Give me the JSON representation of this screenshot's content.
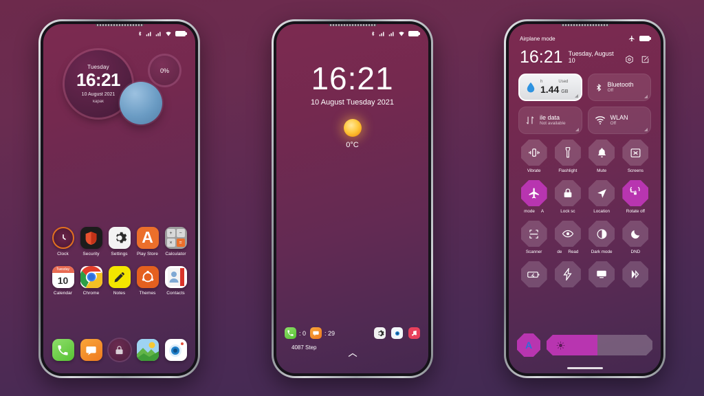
{
  "wallpaper": {
    "bg_top": "#6d2a4c",
    "bg_bottom": "#3f2a52",
    "screen_top": "#7c2a50",
    "screen_bottom": "#45284f",
    "accent": "#b835b0"
  },
  "phone1": {
    "name": "home-screen",
    "statusbar": {
      "icons": [
        "bluetooth-icon",
        "signal-1-icon",
        "signal-2-icon",
        "wifi-icon",
        "battery-icon"
      ]
    },
    "clock_widget": {
      "day": "Tuesday",
      "time": "16:21",
      "date": "10 August 2021",
      "subtitle": "kapak"
    },
    "battery_ring": {
      "value": "0%"
    },
    "apps_row1": [
      {
        "label": "Clock",
        "icon": "clock-icon"
      },
      {
        "label": "Security",
        "icon": "shield-icon"
      },
      {
        "label": "Settings",
        "icon": "gear-icon"
      },
      {
        "label": "Play Store",
        "icon": "play-store-icon"
      },
      {
        "label": "Calculator",
        "icon": "calculator-icon"
      }
    ],
    "apps_row2": [
      {
        "label": "Calendar",
        "icon": "calendar-icon",
        "day_name": "Tuesday",
        "day_num": "10"
      },
      {
        "label": "Chrome",
        "icon": "chrome-icon"
      },
      {
        "label": "Notes",
        "icon": "pencil-icon"
      },
      {
        "label": "Themes",
        "icon": "themes-icon"
      },
      {
        "label": "Contacts",
        "icon": "contacts-icon"
      }
    ],
    "dock": [
      {
        "label": "Phone",
        "icon": "phone-icon"
      },
      {
        "label": "Messages",
        "icon": "message-icon"
      },
      {
        "label": "Lock",
        "icon": "lock-icon"
      },
      {
        "label": "Gallery",
        "icon": "gallery-icon"
      },
      {
        "label": "Camera",
        "icon": "camera-icon"
      }
    ]
  },
  "phone2": {
    "name": "lock-screen",
    "statusbar": {
      "icons": [
        "bluetooth-icon",
        "signal-1-icon",
        "signal-2-icon",
        "wifi-icon",
        "battery-icon"
      ]
    },
    "time": "16:21",
    "date": "10 August Tuesday 2021",
    "weather_icon": "sun-icon",
    "temperature": "0°C",
    "shortcuts": {
      "phone_icon": "phone-icon",
      "phone_count": ": 0",
      "message_icon": "message-icon",
      "message_count": ": 29",
      "right_icons": [
        "settings-icon",
        "camera-icon",
        "music-icon"
      ]
    },
    "steps": "4087 Step",
    "swipe_hint": "chevron-up-icon"
  },
  "phone3": {
    "name": "control-center",
    "statusbar": {
      "left_text": "Airplane mode",
      "right_icons": [
        "airplane-icon",
        "battery-icon"
      ]
    },
    "time": "16:21",
    "date": "Tuesday, August 10",
    "header_actions": [
      "settings-icon",
      "edit-icon"
    ],
    "big_tiles": [
      {
        "title_head_left": "h",
        "title_head_right": "Used",
        "value": "1.44",
        "unit": "GB",
        "icon": "data-drop-icon",
        "active": true,
        "name": "data-usage-tile"
      },
      {
        "title": "Bluetooth",
        "sub": "Off",
        "icon": "bluetooth-icon",
        "active": false,
        "name": "bluetooth-tile"
      },
      {
        "title": "ile data",
        "sub": "Not available",
        "icon": "mobile-data-icon",
        "active": false,
        "name": "mobile-data-tile"
      },
      {
        "title": "WLAN",
        "sub": "Off",
        "icon": "wifi-icon",
        "active": false,
        "name": "wlan-tile"
      }
    ],
    "quick_settings": [
      {
        "label": "Vibrate",
        "icon": "vibrate-icon",
        "on": false
      },
      {
        "label": "Flashlight",
        "icon": "flashlight-icon",
        "on": false
      },
      {
        "label": "Mute",
        "icon": "bell-icon",
        "on": false
      },
      {
        "label": "Screens",
        "icon": "screenshot-icon",
        "on": false
      },
      {
        "label": "mode",
        "label2": "A",
        "icon": "airplane-icon",
        "on": true
      },
      {
        "label": "Lock sc",
        "icon": "lock-icon",
        "on": false
      },
      {
        "label": "Location",
        "icon": "location-icon",
        "on": false
      },
      {
        "label": "Rotate off",
        "icon": "rotate-lock-icon",
        "on": true
      },
      {
        "label": "Scanner",
        "icon": "scanner-icon",
        "on": false
      },
      {
        "label": "de",
        "label2": "Read",
        "icon": "eye-icon",
        "on": false
      },
      {
        "label": "Dark mode",
        "icon": "contrast-icon",
        "on": false
      },
      {
        "label": "DND",
        "icon": "moon-icon",
        "on": false
      },
      {
        "label": "",
        "icon": "battery-saver-icon",
        "on": false
      },
      {
        "label": "",
        "icon": "bolt-icon",
        "on": false
      },
      {
        "label": "",
        "icon": "cast-icon",
        "on": false
      },
      {
        "label": "",
        "icon": "dual-apps-icon",
        "on": false
      }
    ],
    "auto_brightness": {
      "label": "A",
      "icon": "auto-brightness-icon"
    },
    "brightness_slider": {
      "icon": "brightness-icon",
      "percent": 48
    }
  }
}
